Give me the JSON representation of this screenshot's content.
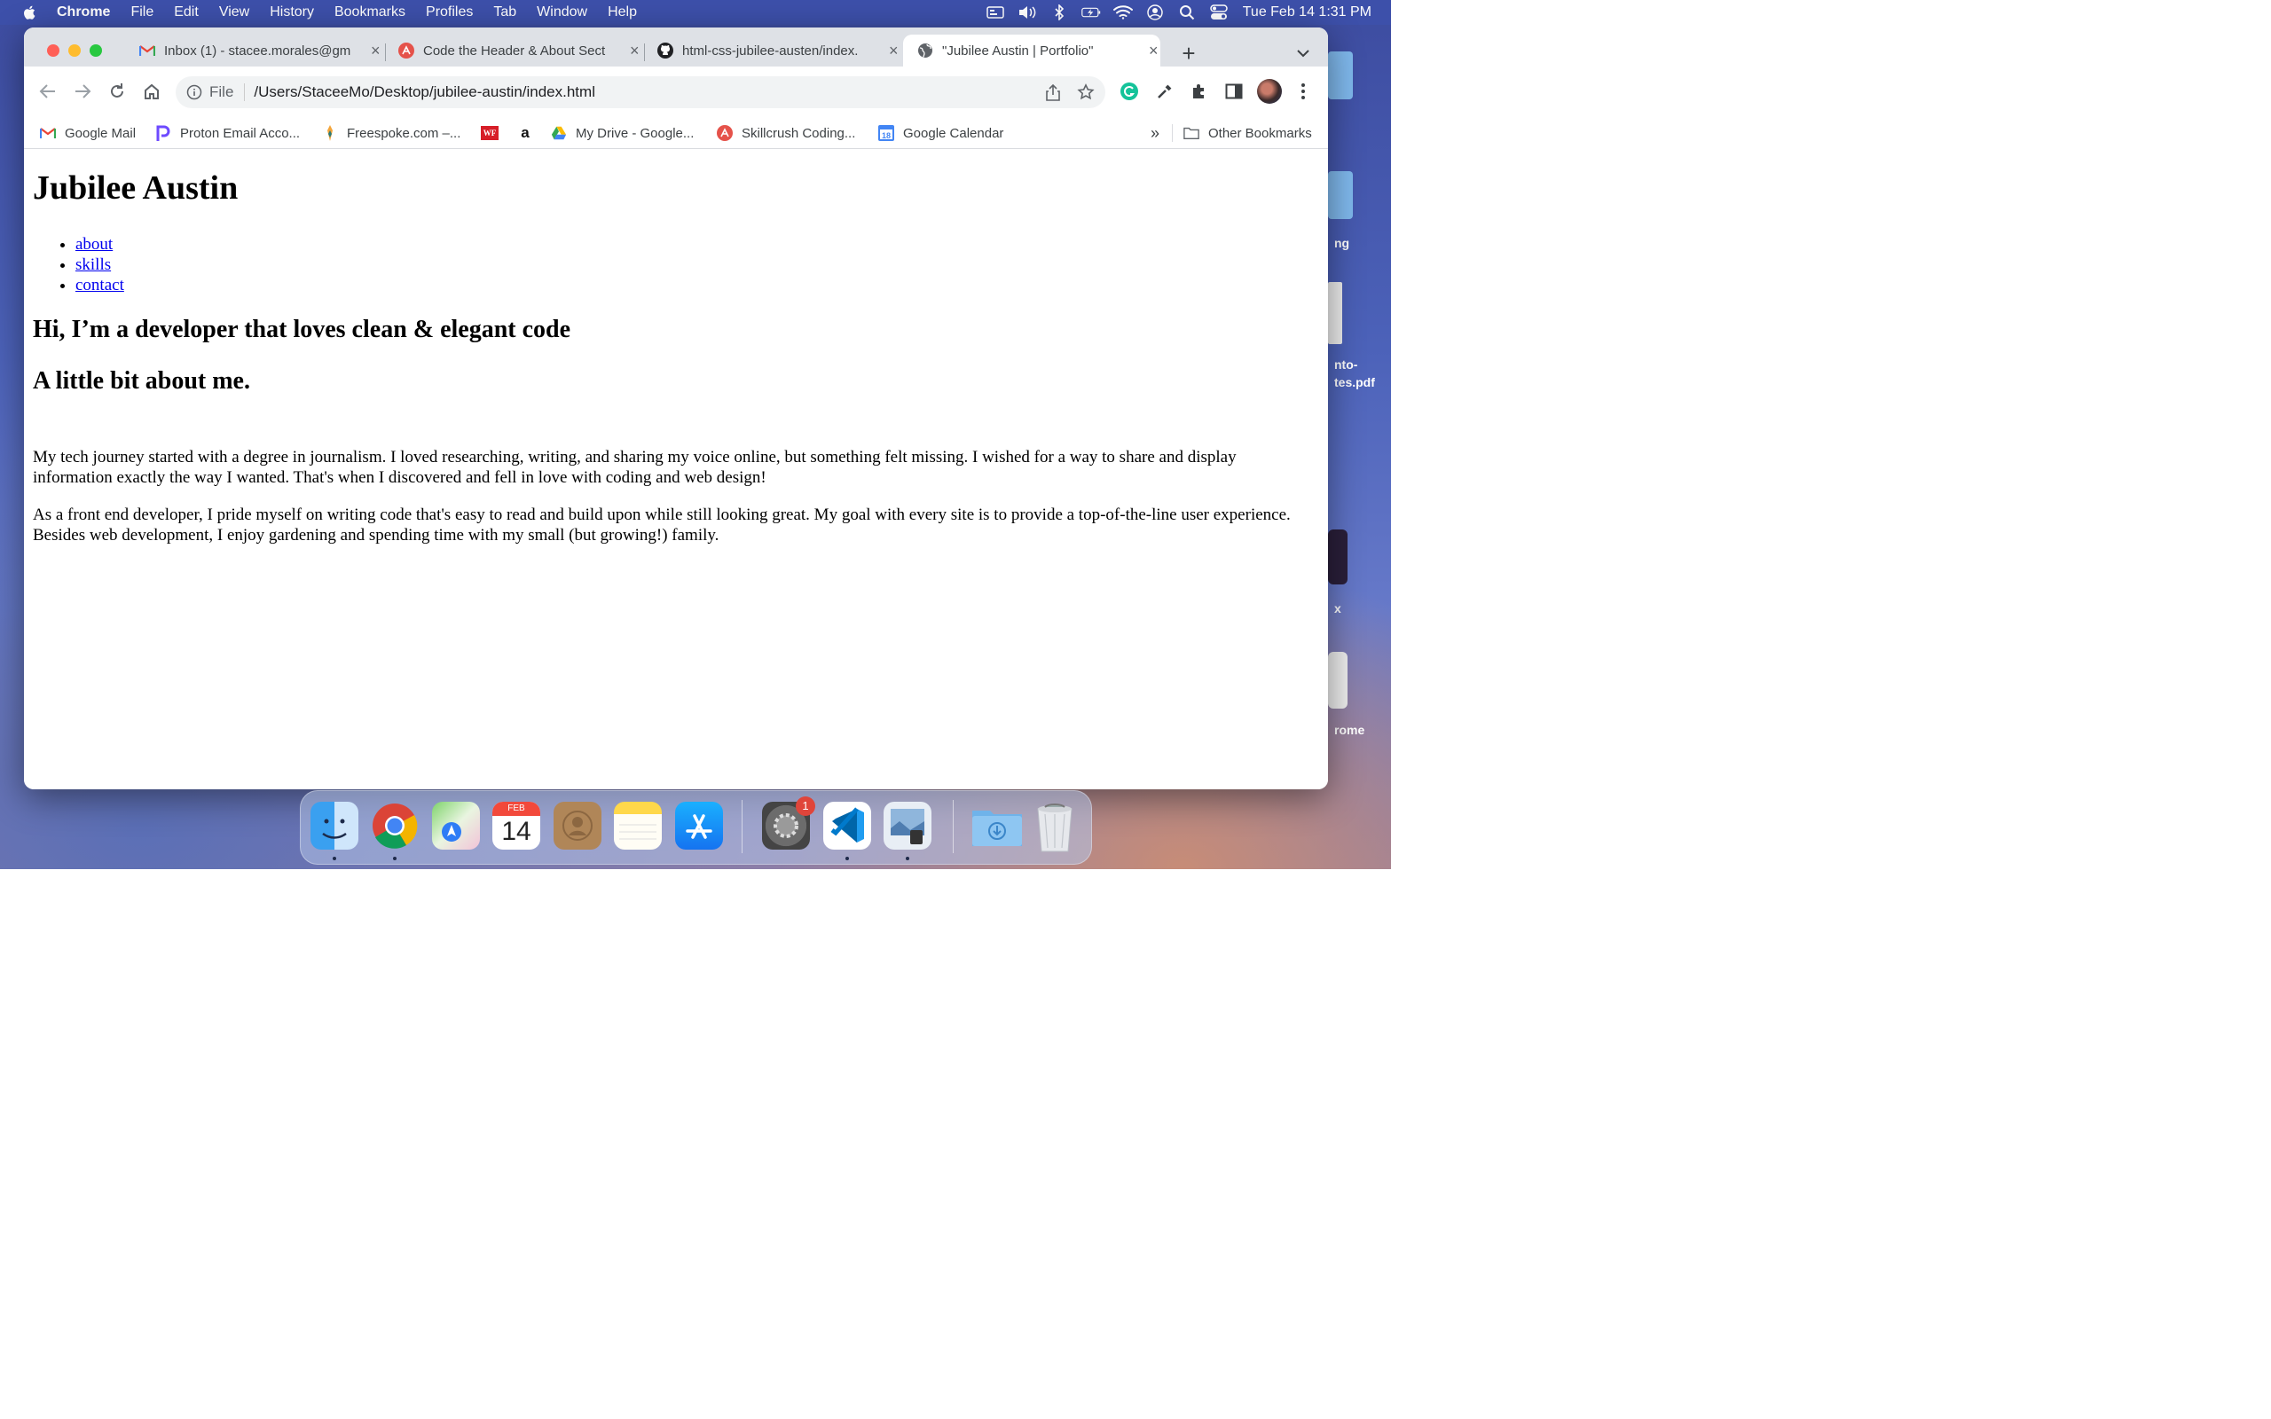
{
  "menubar": {
    "app_name": "Chrome",
    "items": [
      "File",
      "Edit",
      "View",
      "History",
      "Bookmarks",
      "Profiles",
      "Tab",
      "Window",
      "Help"
    ],
    "clock": "Tue Feb 14  1:31 PM"
  },
  "tabs": [
    {
      "title": "Inbox (1) - stacee.morales@gm",
      "icon": "gmail-icon",
      "active": false
    },
    {
      "title": "Code the Header & About Sect",
      "icon": "skillcrush-icon",
      "active": false
    },
    {
      "title": "html-css-jubilee-austen/index.",
      "icon": "github-icon",
      "active": false
    },
    {
      "title": "\"Jubilee Austin | Portfolio\"",
      "icon": "globe-icon",
      "active": true
    }
  ],
  "omnibox": {
    "scheme": "File",
    "url": "/Users/StaceeMo/Desktop/jubilee-austin/index.html"
  },
  "bookmarks": [
    {
      "label": "Google Mail",
      "icon": "gmail-icon"
    },
    {
      "label": "Proton Email Acco...",
      "icon": "proton-icon"
    },
    {
      "label": "Freespoke.com –...",
      "icon": "freespoke-icon"
    },
    {
      "label": "",
      "icon": "wf-icon"
    },
    {
      "label": "",
      "icon": "amazon-icon"
    },
    {
      "label": "My Drive - Google...",
      "icon": "google-drive-icon"
    },
    {
      "label": "Skillcrush Coding...",
      "icon": "skillcrush-icon"
    },
    {
      "label": "Google Calendar",
      "icon": "calendar-icon"
    }
  ],
  "bookmarks_overflow": "»",
  "other_bookmarks": "Other Bookmarks",
  "page": {
    "heading": "Jubilee Austin",
    "nav": [
      "about",
      "skills",
      "contact"
    ],
    "hero": "Hi, I’m a developer that loves clean & elegant code",
    "about_heading": "A little bit about me.",
    "paragraph1": "My tech journey started with a degree in journalism. I loved researching, writing, and sharing my voice online, but something felt missing. I wished for a way to share and display information exactly the way I wanted. That's when I discovered and fell in love with coding and web design!",
    "paragraph2": "As a front end developer, I pride myself on writing code that's easy to read and build upon while still looking great. My goal with every site is to provide a top-of-the-line user experience. Besides web development, I enjoy gardening and spending time with my small (but growing!) family."
  },
  "desktop_labels": [
    "ng",
    "nto-",
    "tes.pdf",
    "x",
    "rome"
  ],
  "dock": {
    "apps": [
      "finder-icon",
      "chrome-icon",
      "maps-icon",
      "calendar-icon",
      "contacts-icon",
      "notes-icon",
      "app-store-icon",
      "system-preferences-icon",
      "vscode-icon",
      "preview-icon",
      "downloads-folder-icon",
      "trash-icon"
    ],
    "calendar_month": "FEB",
    "calendar_day": "14",
    "settings_badge": "1"
  },
  "colors": {
    "menubar": "#3d50aa",
    "tabstrip": "#dee1e6",
    "link": "#0000ee"
  }
}
